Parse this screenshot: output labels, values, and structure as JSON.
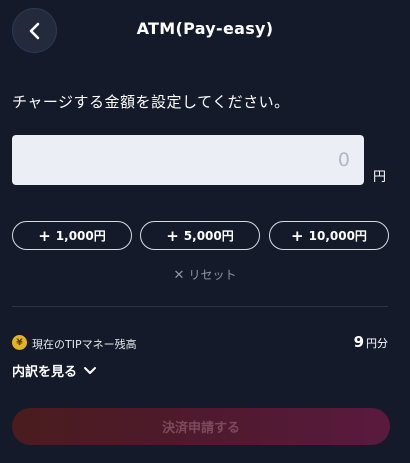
{
  "header": {
    "title": "ATM(Pay-easy)",
    "back_icon": "chevron-left-icon"
  },
  "form": {
    "instruction": "チャージする金額を設定してください。",
    "amount_placeholder": "0",
    "currency_unit": "円"
  },
  "quick_amounts": [
    {
      "label": "1,000円"
    },
    {
      "label": "5,000円"
    },
    {
      "label": "10,000円"
    }
  ],
  "quick_plus_symbol": "+",
  "reset": {
    "symbol": "✕",
    "label": "リセット"
  },
  "balance": {
    "coin_symbol": "¥",
    "label": "現在のTIPマネー残高",
    "value": "9",
    "unit": "円分"
  },
  "breakdown": {
    "label": "内訳を見る"
  },
  "submit": {
    "label": "決済申請する",
    "enabled": false
  },
  "colors": {
    "background": "#141a2a",
    "coin": "#e2b51f",
    "submit_gradient_end": "#5a1a3f"
  }
}
